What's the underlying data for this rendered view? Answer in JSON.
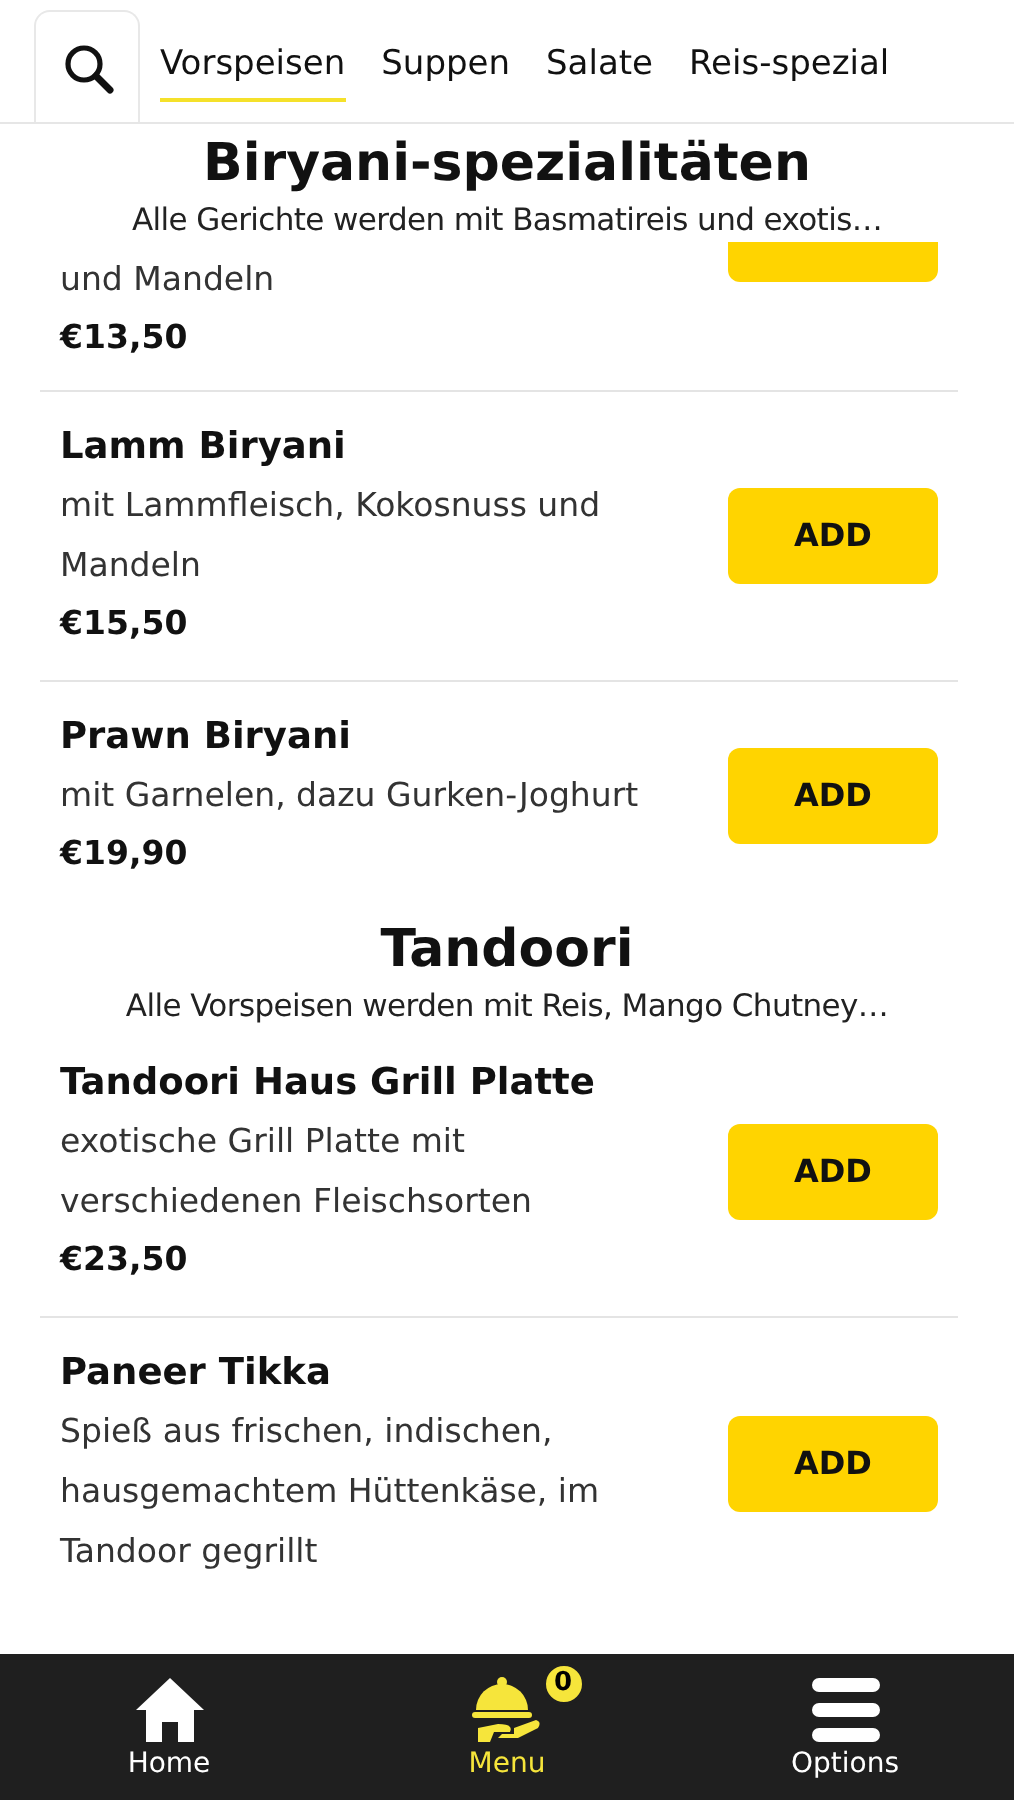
{
  "tabs": [
    {
      "label": "Vorspeisen",
      "selected": true
    },
    {
      "label": "Suppen",
      "selected": false
    },
    {
      "label": "Salate",
      "selected": false
    },
    {
      "label": "Reis-spezial",
      "selected": false
    }
  ],
  "sections": [
    {
      "title": "Biryani-spezialitäten",
      "subtitle": "Alle Gerichte werden mit Basmatireis und exotis…",
      "items": [
        {
          "description": "und Mandeln",
          "price": "€13,50"
        },
        {
          "name": "Lamm Biryani",
          "description": "mit Lammfleisch, Kokosnuss und Mandeln",
          "price": "€15,50",
          "button": "ADD"
        },
        {
          "name": "Prawn Biryani",
          "description": "mit Garnelen, dazu Gurken-Joghurt",
          "price": "€19,90",
          "button": "ADD"
        }
      ]
    },
    {
      "title": "Tandoori",
      "subtitle": "Alle Vorspeisen werden mit Reis, Mango Chutney…",
      "items": [
        {
          "name": "Tandoori Haus Grill Platte",
          "description": "exotische Grill Platte mit verschiedenen Fleischsorten",
          "price": "€23,50",
          "button": "ADD"
        },
        {
          "name": "Paneer Tikka",
          "description": "Spieß aus frischen, indischen, hausgemachtem Hüttenkäse, im Tandoor gegrillt",
          "button": "ADD"
        }
      ]
    }
  ],
  "nav": [
    {
      "kind": "home",
      "label": "Home",
      "selected": false
    },
    {
      "kind": "menu",
      "label": "Menu",
      "selected": true,
      "badge": "0"
    },
    {
      "kind": "options",
      "label": "Options",
      "selected": false
    }
  ]
}
